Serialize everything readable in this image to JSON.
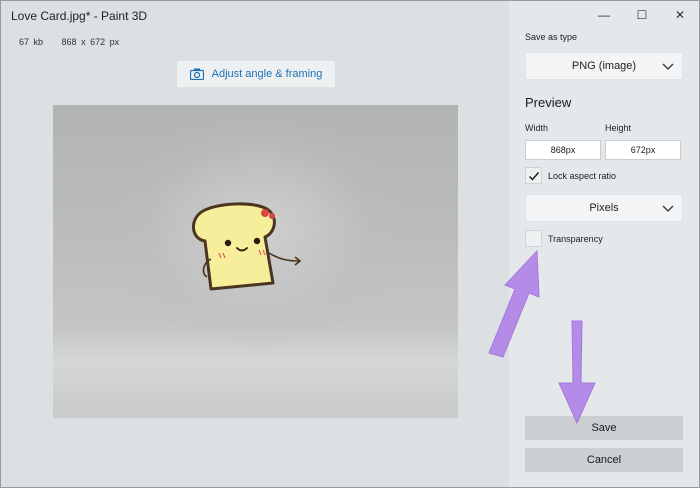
{
  "window": {
    "title": "Love Card.jpg* - Paint 3D"
  },
  "meta": {
    "file_size": "67 kb",
    "dimensions": "868 x 672 px"
  },
  "adjust_button": {
    "label": "Adjust angle & framing",
    "icon": "camera-icon"
  },
  "window_controls": {
    "back_icon": "back-icon",
    "minimize": "—",
    "maximize": "☐",
    "close": "✕"
  },
  "panel": {
    "save_as_type_label": "Save as type",
    "save_as_type_value": "PNG (image)",
    "preview_heading": "Preview",
    "width_label": "Width",
    "height_label": "Height",
    "width_value": "868px",
    "height_value": "672px",
    "lock_aspect_label": "Lock aspect ratio",
    "lock_aspect_checked": true,
    "units_value": "Pixels",
    "transparency_label": "Transparency",
    "transparency_checked": false,
    "save_label": "Save",
    "cancel_label": "Cancel"
  },
  "colors": {
    "accent": "#1f6fb2",
    "annotation_arrow": "#b58be8"
  }
}
